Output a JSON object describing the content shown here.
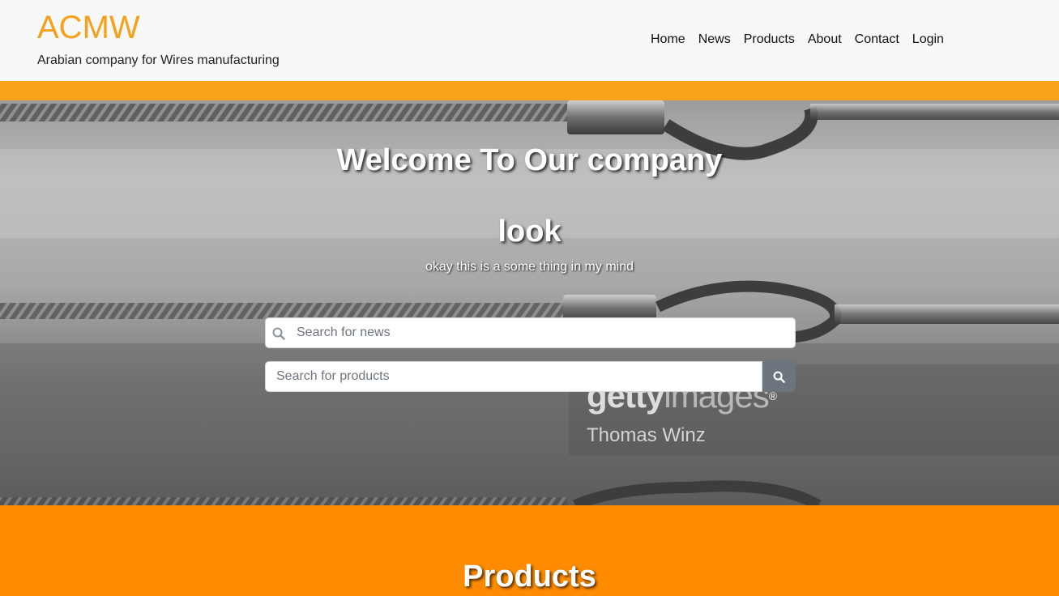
{
  "header": {
    "brand": "ACMW",
    "tagline": "Arabian company for Wires manufacturing",
    "nav": [
      {
        "label": "Home"
      },
      {
        "label": "News"
      },
      {
        "label": "Products"
      },
      {
        "label": "About"
      },
      {
        "label": "Contact"
      },
      {
        "label": "Login"
      }
    ]
  },
  "hero": {
    "title": "Welcome To Our company",
    "subtitle": "look",
    "caption": "okay this is a some thing in my mind",
    "news_search": {
      "placeholder": "Search for news",
      "icon": "search-icon"
    },
    "products_search": {
      "placeholder": "Search for products",
      "button_icon": "search-icon"
    },
    "watermark": {
      "logo_bold": "getty",
      "logo_light": "images",
      "registered": "®",
      "credit": "Thomas Winz"
    }
  },
  "products": {
    "heading": "Products"
  },
  "colors": {
    "brand": "#f5a11a",
    "accent_strip": "#f9a11b",
    "products_bg": "#fe8b00",
    "search_button": "#6c757d"
  }
}
